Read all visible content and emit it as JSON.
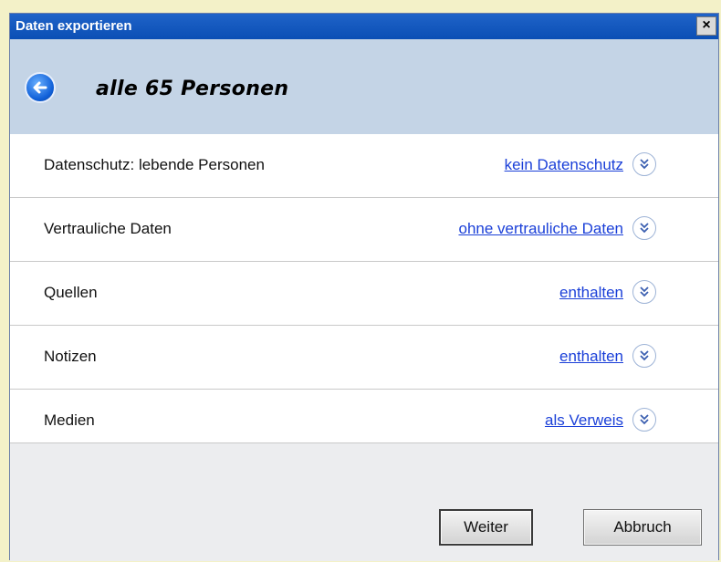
{
  "window": {
    "title": "Daten exportieren",
    "close_label": "×"
  },
  "header": {
    "title": "alle 65 Personen"
  },
  "rows": [
    {
      "label": "Datenschutz: lebende Personen",
      "value": "kein Datenschutz"
    },
    {
      "label": "Vertrauliche Daten",
      "value": "ohne vertrauliche Daten"
    },
    {
      "label": "Quellen",
      "value": "enthalten"
    },
    {
      "label": "Notizen",
      "value": "enthalten"
    },
    {
      "label": "Medien",
      "value": "als Verweis"
    }
  ],
  "footer": {
    "next_label": "Weiter",
    "cancel_label": "Abbruch"
  },
  "colors": {
    "titlebar": "#0b4fb5",
    "header_bg": "#c4d4e6",
    "link": "#1a3fd8",
    "page_bg": "#f3f1c8"
  }
}
